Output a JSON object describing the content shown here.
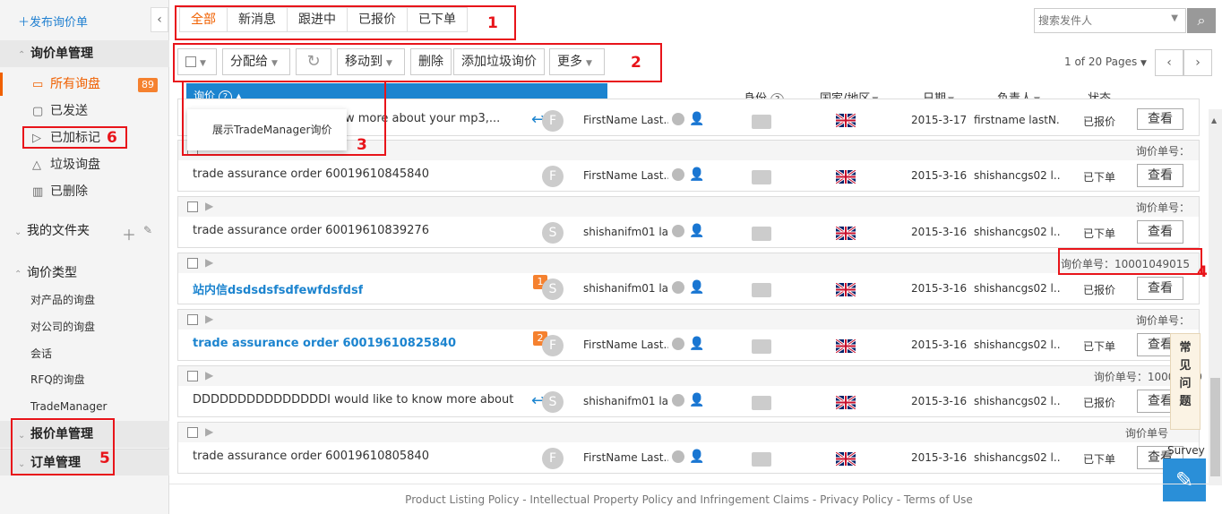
{
  "sidebar": {
    "publish": "发布询价单",
    "inquiry_mgmt": "询价单管理",
    "items": [
      {
        "label": "所有询盘",
        "badge": "89"
      },
      {
        "label": "已发送"
      },
      {
        "label": "已加标记"
      },
      {
        "label": "垃圾询盘"
      },
      {
        "label": "已删除"
      }
    ],
    "my_folders": "我的文件夹",
    "inquiry_types": "询价类型",
    "types": [
      "对产品的询盘",
      "对公司的询盘",
      "会话",
      "RFQ的询盘",
      "TradeManager"
    ],
    "quote_mgmt": "报价单管理",
    "order_mgmt": "订单管理"
  },
  "tabs": [
    "全部",
    "新消息",
    "跟进中",
    "已报价",
    "已下单"
  ],
  "search": {
    "placeholder": "搜索发件人"
  },
  "toolbar": {
    "assign": "分配给",
    "move_to": "移动到",
    "delete": "删除",
    "add_spam": "添加垃圾询价",
    "more": "更多"
  },
  "pagination": {
    "text": "1 of 20 Pages"
  },
  "columns": {
    "inquiry": "询价",
    "identity": "身份",
    "country": "国家/地区",
    "date": "日期",
    "owner": "负责人",
    "status": "状态"
  },
  "dropdown": {
    "item": "展示TradeManager询价"
  },
  "rows": [
    {
      "order_no": "",
      "subject": "ow more about your mp3,...",
      "avatar": "F",
      "name": "FirstName Last...",
      "date": "2015-3-17",
      "owner": "firstname lastN...",
      "status": "已报价",
      "view": "查看"
    },
    {
      "order_no": "询价单号：",
      "subject": "trade assurance order 60019610845840",
      "avatar": "F",
      "name": "FirstName Last...",
      "date": "2015-3-16",
      "owner": "shishancgs02 l...",
      "status": "已下单",
      "view": "查看"
    },
    {
      "order_no": "询价单号：",
      "subject": "trade assurance order 60019610839276",
      "avatar": "S",
      "name": "shishanifm01 la...",
      "date": "2015-3-16",
      "owner": "shishancgs02 l...",
      "status": "已下单",
      "view": "查看"
    },
    {
      "order_no": "询价单号：10001049015",
      "subject": "站内信dsdsdsfsdfewfdsfdsf",
      "num": "1",
      "avatar": "S",
      "name": "shishanifm01 la...",
      "date": "2015-3-16",
      "owner": "shishancgs02 l...",
      "status": "已报价",
      "view": "查看"
    },
    {
      "order_no": "询价单号：",
      "subject": "trade assurance order 60019610825840",
      "num": "2",
      "avatar": "F",
      "name": "FirstName Last...",
      "date": "2015-3-16",
      "owner": "shishancgs02 l...",
      "status": "已下单",
      "view": "查看"
    },
    {
      "order_no": "询价单号：10001049",
      "subject": "DDDDDDDDDDDDDDDI would like to know more about ...",
      "avatar": "S",
      "name": "shishanifm01 la...",
      "date": "2015-3-16",
      "owner": "shishancgs02 l...",
      "status": "已报价",
      "view": "查看"
    },
    {
      "order_no": "询价单号",
      "subject": "trade assurance order 60019610805840",
      "avatar": "F",
      "name": "FirstName Last...",
      "date": "2015-3-16",
      "owner": "shishancgs02 l...",
      "status": "已下单",
      "view": "查看"
    }
  ],
  "help": {
    "faq": [
      "常",
      "见",
      "问",
      "题"
    ],
    "survey": "Survey"
  },
  "footer": "Product Listing Policy - Intellectual Property Policy and Infringement Claims - Privacy Policy - Terms of Use",
  "annotations": [
    "1",
    "2",
    "3",
    "4",
    "5",
    "6"
  ],
  "colors": {
    "accent": "#f06000",
    "blue": "#1c84cf",
    "annotation": "#e8141a"
  }
}
